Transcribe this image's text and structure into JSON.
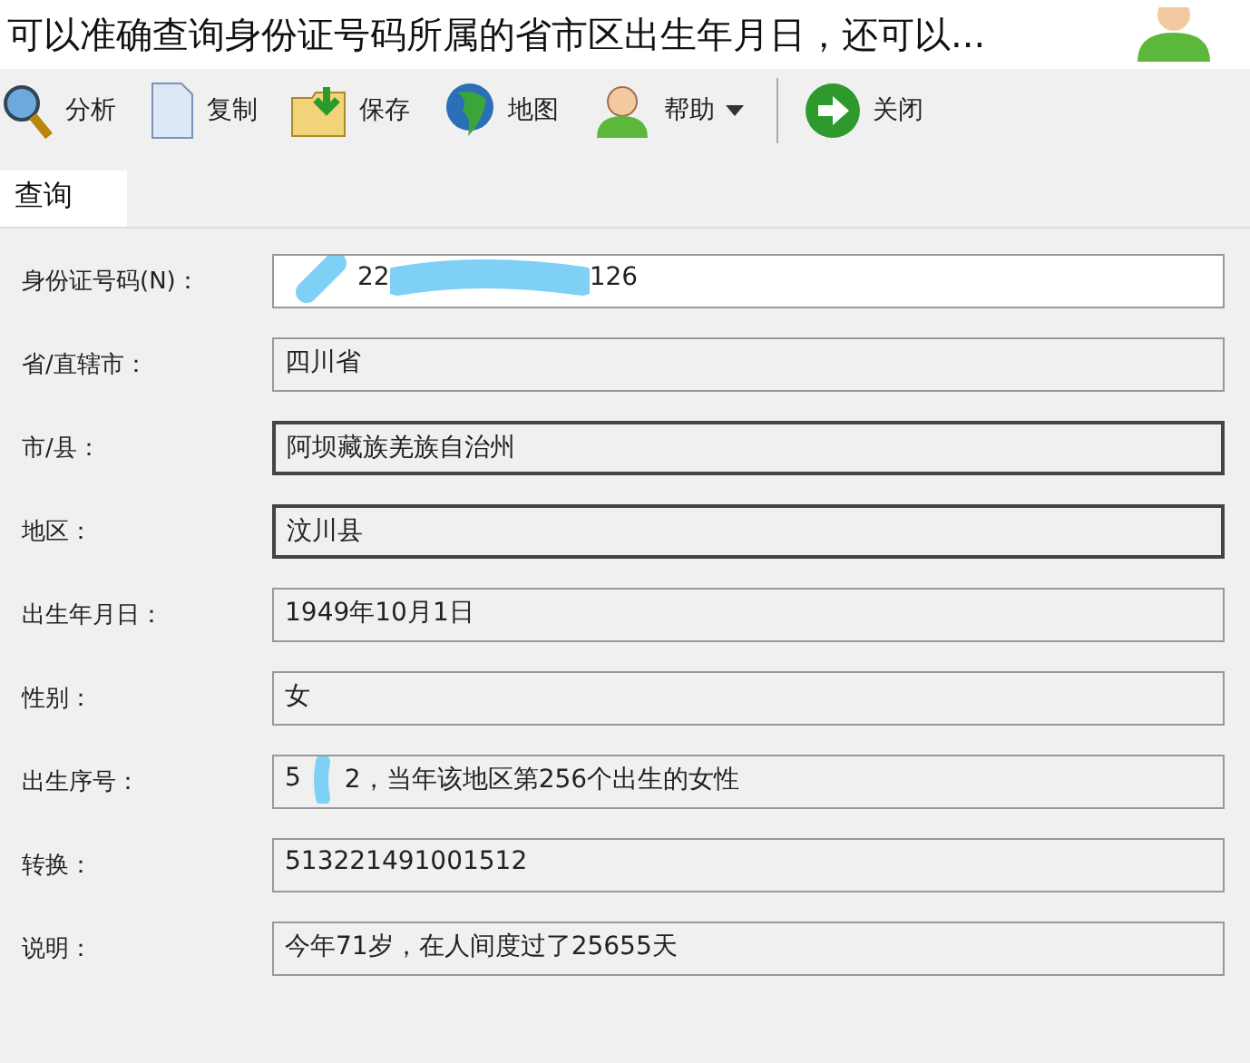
{
  "header": {
    "title": "可以准确查询身份证号码所属的省市区出生年月日，还可以..."
  },
  "toolbar": [
    {
      "kind": "search",
      "label": "分析",
      "dropdown": false
    },
    {
      "kind": "document",
      "label": "复制",
      "dropdown": false
    },
    {
      "kind": "folder",
      "label": "保存",
      "dropdown": false
    },
    {
      "kind": "globe",
      "label": "地图",
      "dropdown": false
    },
    {
      "kind": "user",
      "label": "帮助",
      "dropdown": true
    },
    {
      "kind": "exit",
      "label": "关闭",
      "dropdown": false
    }
  ],
  "tabs": [
    {
      "label": "查询",
      "selected": true
    }
  ],
  "fields": [
    {
      "label": "身份证号码(N)：",
      "editable": true,
      "highlighted": false,
      "parts": [
        "22",
        "126"
      ]
    },
    {
      "label": "省/直辖市：",
      "editable": false,
      "highlighted": false,
      "parts": [
        "四川省"
      ]
    },
    {
      "label": "市/县：",
      "editable": false,
      "highlighted": true,
      "parts": [
        "阿坝藏族羌族自治州"
      ]
    },
    {
      "label": "地区：",
      "editable": false,
      "highlighted": true,
      "parts": [
        "汶川县"
      ]
    },
    {
      "label": "出生年月日：",
      "editable": false,
      "highlighted": false,
      "parts": [
        "1949年10月1日"
      ]
    },
    {
      "label": "性别：",
      "editable": false,
      "highlighted": false,
      "parts": [
        "女"
      ]
    },
    {
      "label": "出生序号：",
      "editable": false,
      "highlighted": false,
      "parts": [
        "5",
        "2，当年该地区第256个出生的女性"
      ]
    },
    {
      "label": "转换：",
      "editable": false,
      "highlighted": false,
      "parts": [
        "513221491001512"
      ]
    },
    {
      "label": "说明：",
      "editable": false,
      "highlighted": false,
      "parts": [
        "今年71岁，在人间度过了25655天"
      ]
    }
  ]
}
